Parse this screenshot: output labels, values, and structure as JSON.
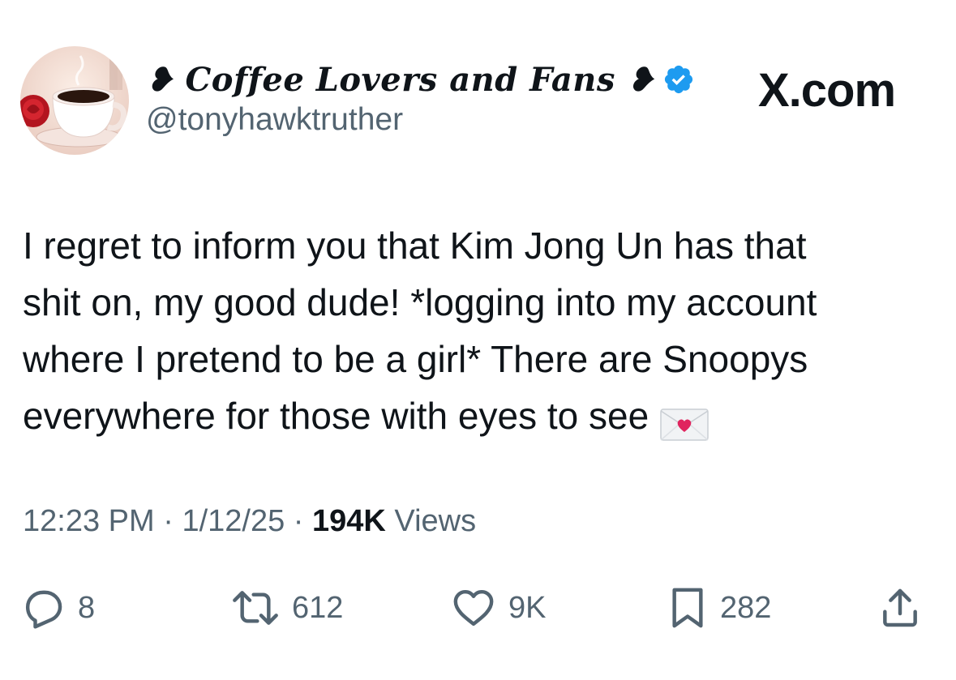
{
  "author": {
    "display_name": "Coffee Lovers and Fans",
    "name_decoration_left": "❥",
    "name_decoration_right": "❥",
    "handle": "@tonyhawktruther",
    "verified": true,
    "verified_color": "#1d9bf0"
  },
  "brand": {
    "label": "X.com"
  },
  "tweet": {
    "lines": [
      "I regret to inform you that Kim Jong Un has that",
      "shit on, my good dude! *logging into my account",
      "where I pretend to be a girl* There are Snoopys",
      "everywhere for those with eyes to see"
    ],
    "trailing_emoji": "love-letter-icon"
  },
  "meta": {
    "time": "12:23 PM",
    "separator": "·",
    "date": "1/12/25",
    "views_count": "194K",
    "views_label": "Views"
  },
  "actions": {
    "replies": "8",
    "reposts": "612",
    "likes": "9K",
    "bookmarks": "282"
  },
  "colors": {
    "text": "#0f1419",
    "secondary": "#536471",
    "verified": "#1d9bf0",
    "heart_red": "#e0245e"
  }
}
